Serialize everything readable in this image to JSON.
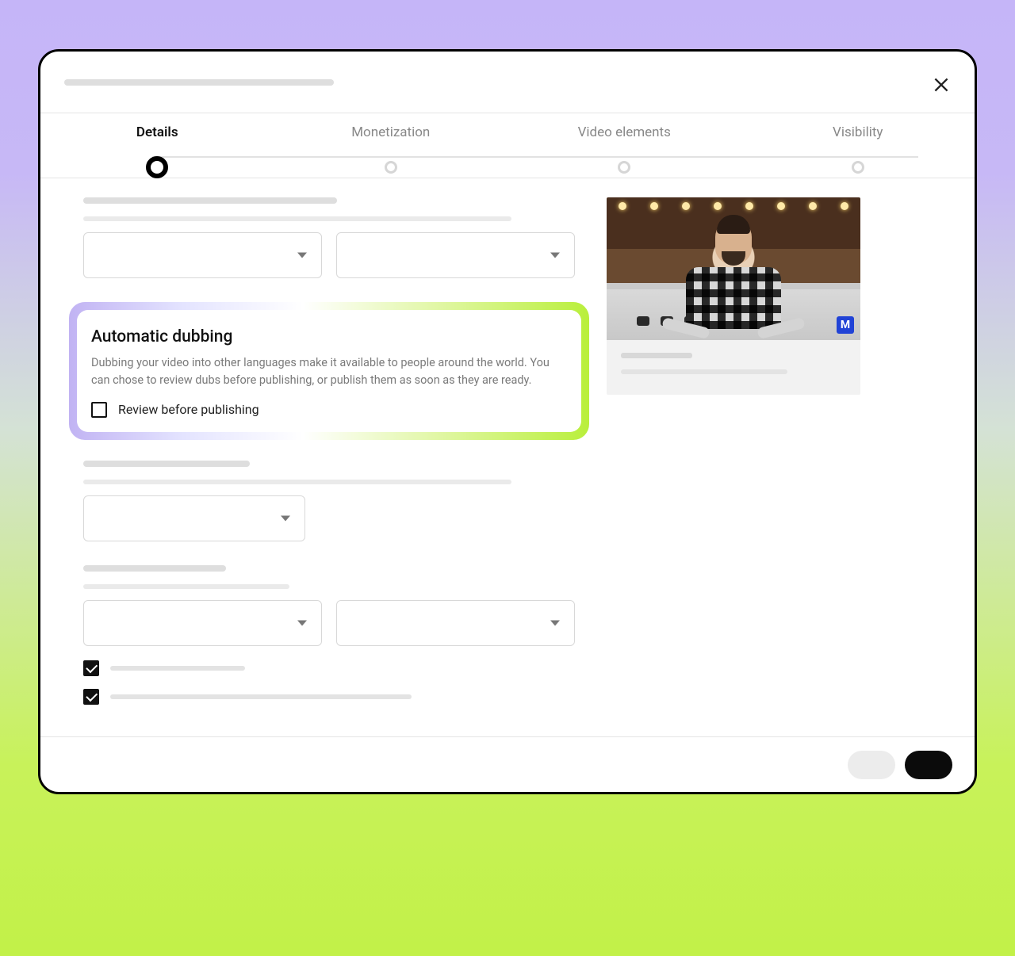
{
  "stepper": {
    "steps": [
      {
        "label": "Details",
        "active": true
      },
      {
        "label": "Monetization",
        "active": false
      },
      {
        "label": "Video elements",
        "active": false
      },
      {
        "label": "Visibility",
        "active": false
      }
    ]
  },
  "dubbing": {
    "title": "Automatic dubbing",
    "description": "Dubbing your video into other languages make it available to people around the world. You can chose to review dubs before publishing, or publish them as soon as they are ready.",
    "checkbox_label": "Review before publishing",
    "checkbox_checked": false
  },
  "bottom_checkboxes": [
    {
      "checked": true
    },
    {
      "checked": true
    }
  ],
  "preview": {
    "badge": "M"
  }
}
